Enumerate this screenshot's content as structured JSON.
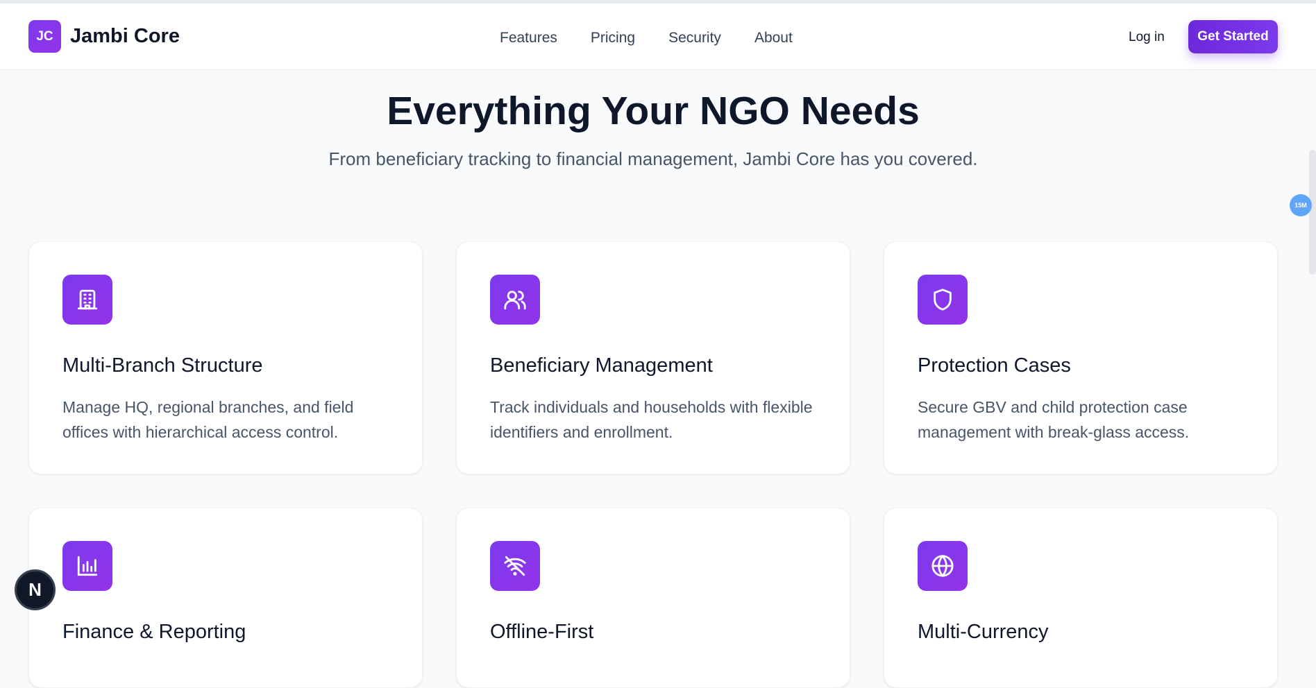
{
  "header": {
    "logo_mark": "JC",
    "brand": "Jambi Core",
    "nav": [
      "Features",
      "Pricing",
      "Security",
      "About"
    ],
    "login": "Log in",
    "cta": "Get Started"
  },
  "hero": {
    "title": "Everything Your NGO Needs",
    "subtitle": "From beneficiary tracking to financial management, Jambi Core has you covered."
  },
  "features": [
    {
      "icon": "building-icon",
      "title": "Multi-Branch Structure",
      "desc": "Manage HQ, regional branches, and field offices with hierarchical access control."
    },
    {
      "icon": "users-icon",
      "title": "Beneficiary Management",
      "desc": "Track individuals and households with flexible identifiers and enrollment."
    },
    {
      "icon": "shield-icon",
      "title": "Protection Cases",
      "desc": "Secure GBV and child protection case management with break-glass access."
    },
    {
      "icon": "bar-chart-icon",
      "title": "Finance & Reporting",
      "desc": ""
    },
    {
      "icon": "wifi-off-icon",
      "title": "Offline-First",
      "desc": ""
    },
    {
      "icon": "globe-icon",
      "title": "Multi-Currency",
      "desc": ""
    }
  ],
  "overlay": {
    "badge": "15M",
    "dev_button": "N"
  },
  "colors": {
    "accent": "#7c3aed",
    "heading": "#0f172a",
    "body_text": "#475569",
    "background": "#f8fafc"
  }
}
